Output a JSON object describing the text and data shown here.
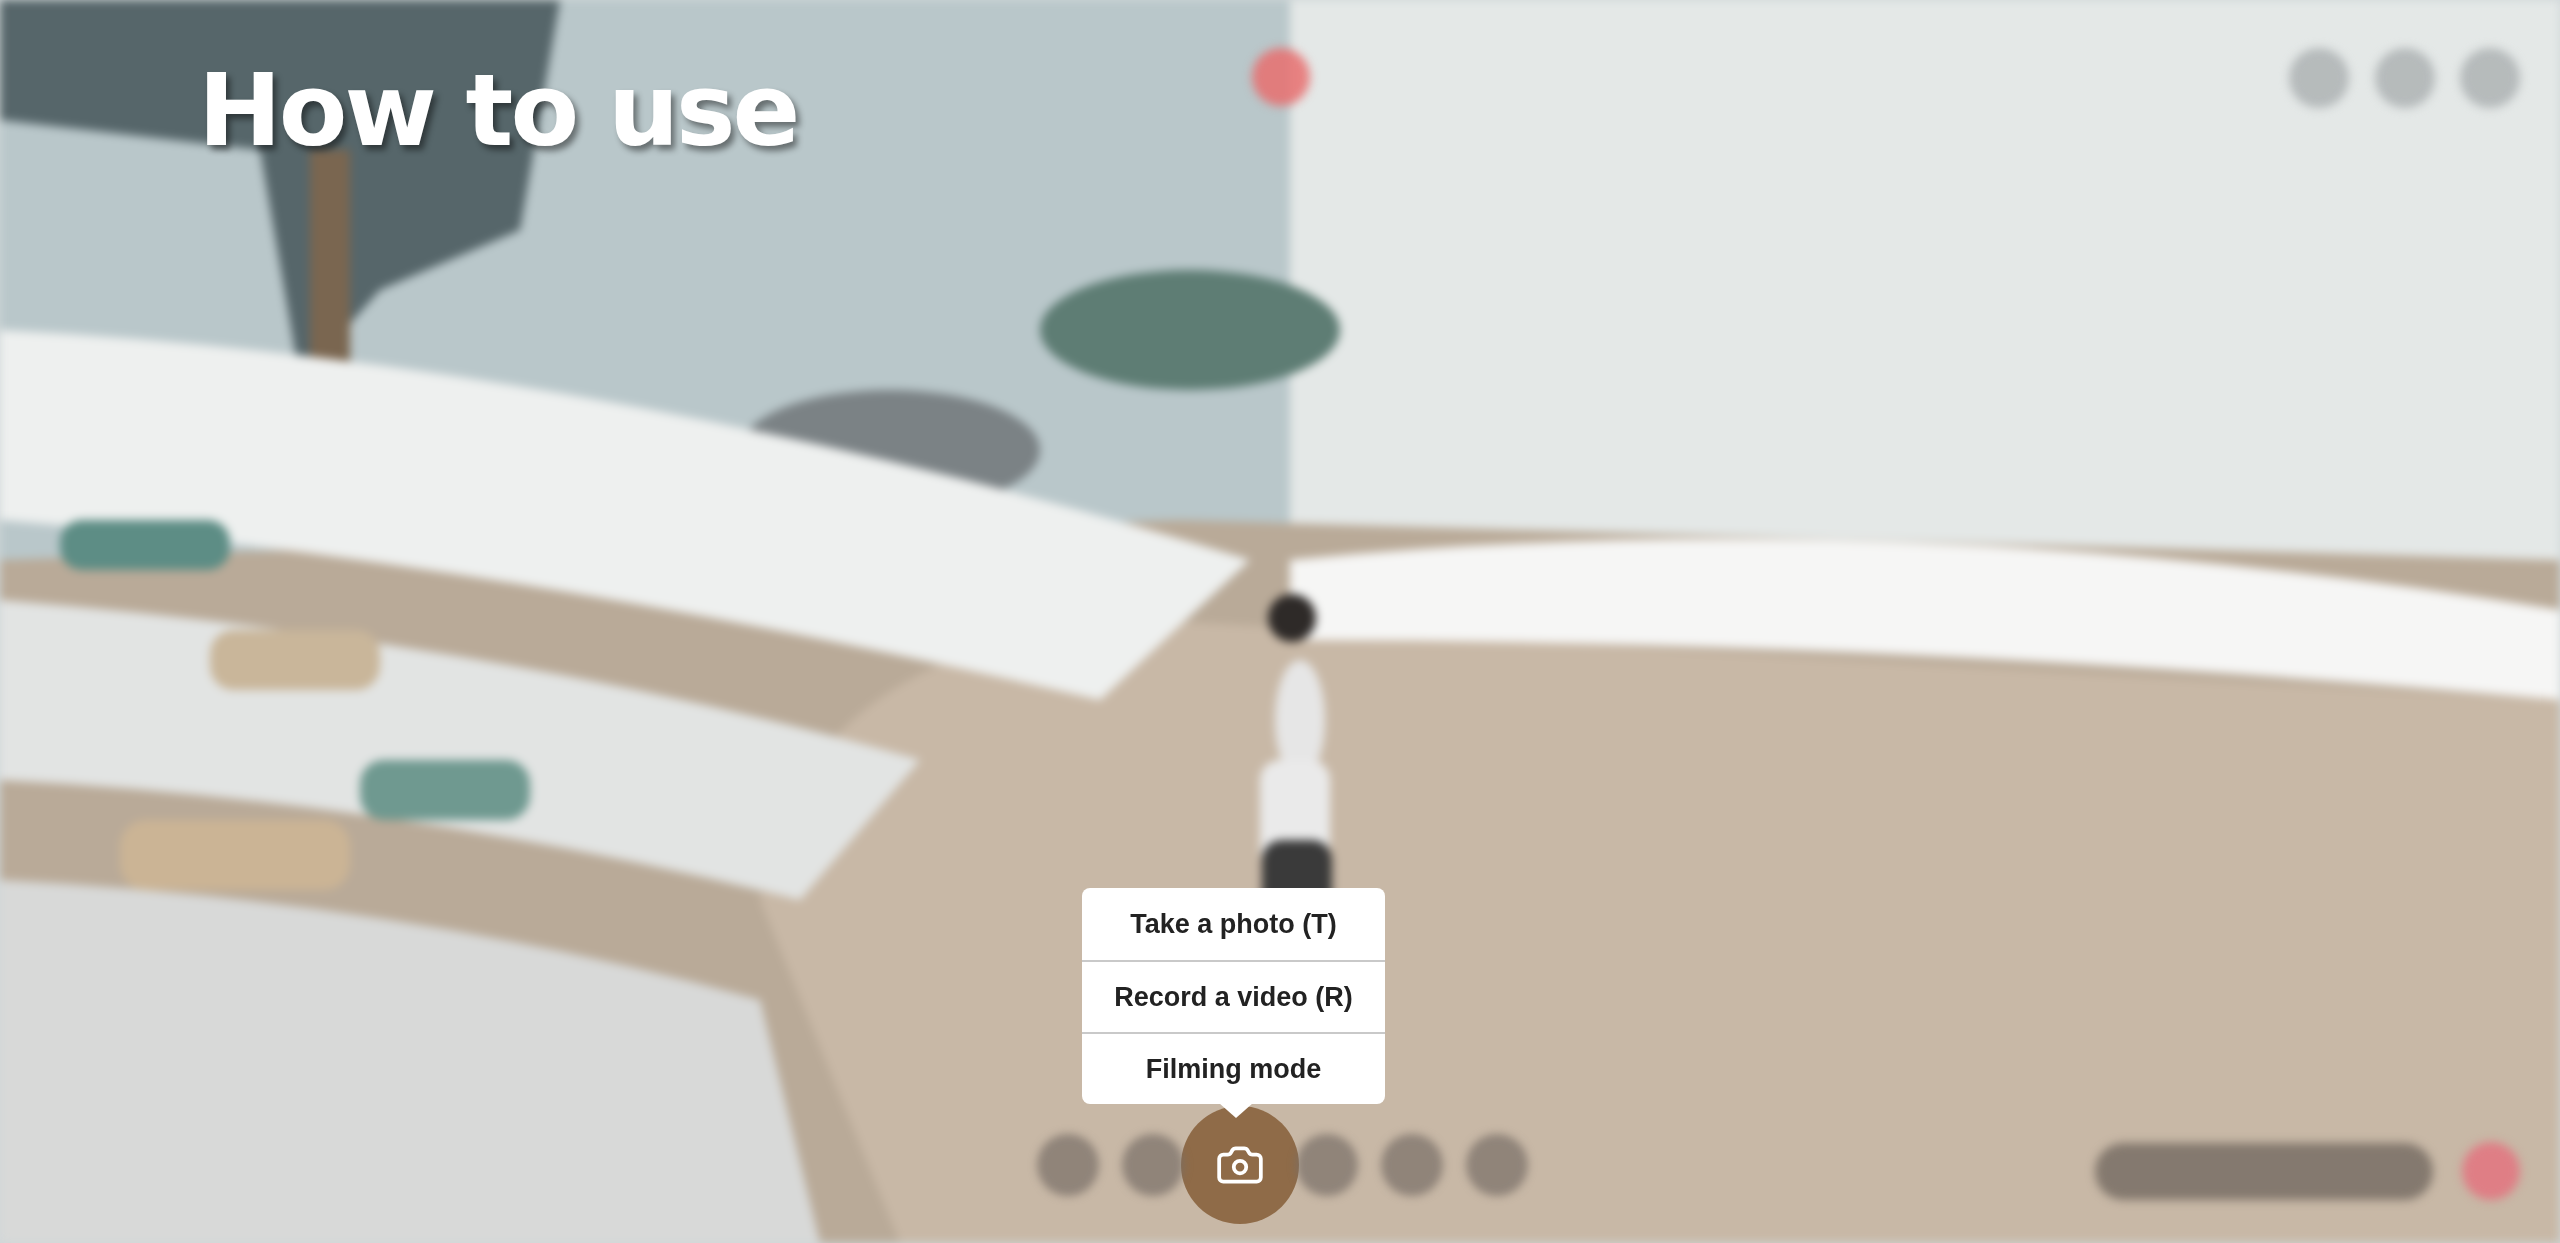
{
  "heading": "How to use",
  "camera_menu": {
    "items": [
      {
        "label": "Take a photo (T)"
      },
      {
        "label": "Record a video (R)"
      },
      {
        "label": "Filming mode"
      }
    ]
  },
  "toolbar": {
    "buttons": [
      {
        "selected": false
      },
      {
        "selected": false
      },
      {
        "selected": true
      },
      {
        "selected": false
      },
      {
        "selected": false
      },
      {
        "selected": false
      }
    ]
  }
}
